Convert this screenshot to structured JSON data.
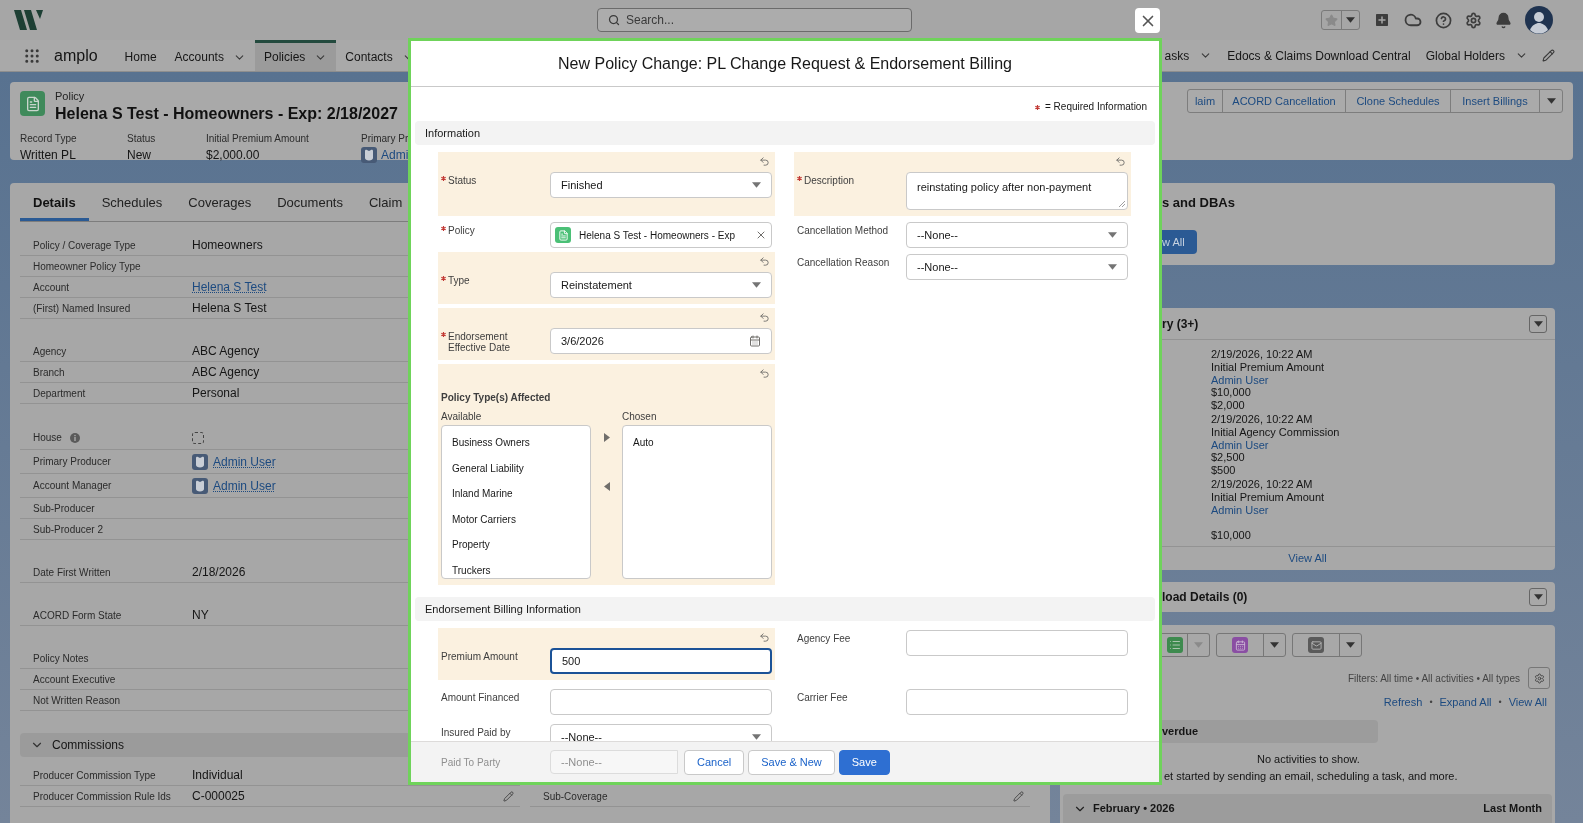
{
  "global_header": {
    "search_placeholder": "Search..."
  },
  "nav": {
    "app_name": "amplo",
    "items": [
      {
        "label": "Home",
        "has_menu": false,
        "selected": false
      },
      {
        "label": "Accounts",
        "has_menu": true,
        "selected": false
      },
      {
        "label": "Policies",
        "has_menu": true,
        "selected": true
      },
      {
        "label": "Contacts",
        "has_menu": true,
        "selected": false
      }
    ],
    "right_items": [
      {
        "label": "asks",
        "has_menu": true
      },
      {
        "label": "Edocs & Claims Download Central",
        "has_menu": false
      },
      {
        "label": "Global Holders",
        "has_menu": true
      }
    ]
  },
  "record": {
    "object_label": "Policy",
    "title": "Helena S Test - Homeowners - Exp: 2/18/2027",
    "fields": [
      {
        "label": "Record Type",
        "value": "Written PL",
        "kind": "text"
      },
      {
        "label": "Status",
        "value": "New",
        "kind": "text"
      },
      {
        "label": "Initial Premium Amount",
        "value": "$2,000.00",
        "kind": "text"
      },
      {
        "label": "Primary Pr",
        "value": "Admi",
        "kind": "user"
      }
    ],
    "actions": [
      "laim",
      "ACORD Cancellation",
      "Clone Schedules",
      "Insert Billings"
    ]
  },
  "tabs": [
    {
      "label": "Details",
      "selected": true
    },
    {
      "label": "Schedules",
      "selected": false
    },
    {
      "label": "Coverages",
      "selected": false
    },
    {
      "label": "Documents",
      "selected": false
    },
    {
      "label": "Claim",
      "selected": false
    }
  ],
  "details": {
    "groups": [
      [
        {
          "label": "Policy / Coverage Type",
          "value": "Homeowners",
          "kind": "text"
        },
        {
          "label": "Homeowner Policy Type",
          "kind": "text"
        },
        {
          "label": "Account",
          "value": "Helena S Test",
          "kind": "link"
        },
        {
          "label": "(First) Named Insured",
          "value": "Helena S Test",
          "kind": "text"
        }
      ],
      [
        {
          "label": "Agency",
          "value": "ABC Agency",
          "kind": "text"
        },
        {
          "label": "Branch",
          "value": "ABC Agency",
          "kind": "text"
        },
        {
          "label": "Department",
          "value": "Personal",
          "kind": "text"
        }
      ],
      [
        {
          "label": "House",
          "kind": "checkbox",
          "checked": false,
          "info": true
        },
        {
          "label": "Primary Producer",
          "value": "Admin User",
          "kind": "user"
        },
        {
          "label": "Account Manager",
          "value": "Admin User",
          "kind": "user"
        },
        {
          "label": "Sub-Producer",
          "kind": "text"
        },
        {
          "label": "Sub-Producer 2",
          "kind": "text"
        }
      ],
      [
        {
          "label": "Date First Written",
          "value": "2/18/2026",
          "kind": "text"
        }
      ],
      [
        {
          "label": "ACORD Form State",
          "value": "NY",
          "kind": "text"
        }
      ],
      [
        {
          "label": "Policy Notes",
          "kind": "text"
        },
        {
          "label": "Account Executive",
          "kind": "text"
        },
        {
          "label": "Not Written Reason",
          "kind": "text"
        }
      ]
    ]
  },
  "commissions": {
    "title": "Commissions",
    "expanded": true,
    "rows": [
      {
        "left": {
          "label": "Producer Commission Type",
          "value": "Individual",
          "editable": false
        }
      },
      {
        "left": {
          "label": "Producer Commission Rule Ids",
          "value": "C-000025",
          "editable": true
        },
        "right": {
          "label": "Sub-Coverage",
          "editable": true
        }
      }
    ]
  },
  "side": {
    "dbas": {
      "title": "s and DBAs",
      "button": "w All"
    },
    "history": {
      "title": "ry (3+)",
      "entries": [
        {
          "date": "2/19/2026, 10:22 AM",
          "field": "Initial Premium Amount",
          "user": "Admin User",
          "new_value": "$10,000",
          "old_value": "$2,000"
        },
        {
          "date": "2/19/2026, 10:22 AM",
          "field": "Initial Agency Commission",
          "user": "Admin User",
          "new_value": "$2,500",
          "old_value": "$500"
        },
        {
          "date": "2/19/2026, 10:22 AM",
          "field": "Initial Premium Amount",
          "user": "Admin User",
          "old_value": "$10,000"
        }
      ],
      "footer_link": "View All"
    },
    "download": {
      "title": "load Details (0)"
    },
    "activity": {
      "composer_buttons": [
        {
          "kind": "task"
        },
        {
          "kind": "event"
        },
        {
          "kind": "email"
        }
      ],
      "filters": "Filters: All time • All activities • All types",
      "links": [
        "Refresh",
        "Expand All",
        "View All"
      ],
      "link_separator": "•",
      "overdue": "verdue",
      "empty_title": "No activities to show.",
      "empty_text": "et started by sending an email, scheduling a task, and more.",
      "month": {
        "label": "February • 2026",
        "note": "Last Month",
        "expanded": true
      }
    }
  },
  "modal": {
    "title": "New Policy Change: PL Change Request & Endorsement Billing",
    "required_note": "= Required Information",
    "sections": [
      {
        "title": "Information",
        "rows": [
          {
            "left": {
              "label": "Status",
              "kind": "select",
              "value": "Finished",
              "required": true,
              "changed": true
            },
            "right": {
              "label": "Description",
              "kind": "textarea",
              "value": "reinstating policy after non-payment",
              "required": true,
              "changed": true
            }
          },
          {
            "left": {
              "label": "Policy",
              "kind": "lookup",
              "value": "Helena S Test - Homeowners - Exp",
              "required": true,
              "changed": false
            },
            "right": {
              "label": "Cancellation Method",
              "kind": "select",
              "value": "--None--",
              "required": false,
              "changed": false
            }
          },
          {
            "left": {
              "label": "Type",
              "kind": "select",
              "value": "Reinstatement",
              "required": true,
              "changed": true
            },
            "right": {
              "label": "Cancellation Reason",
              "kind": "select",
              "value": "--None--",
              "required": false,
              "changed": false
            }
          },
          {
            "left": {
              "label": "Endorsement Effective Date",
              "kind": "date",
              "value": "3/6/2026",
              "required": true,
              "changed": true
            }
          },
          {
            "left": {
              "label": "Policy Type(s) Affected",
              "kind": "dual_list",
              "changed": true,
              "available_label": "Available",
              "chosen_label": "Chosen",
              "available": [
                "Business Owners",
                "General Liability",
                "Inland Marine",
                "Motor Carriers",
                "Property",
                "Truckers"
              ],
              "chosen": [
                "Auto"
              ]
            }
          }
        ]
      },
      {
        "title": "Endorsement Billing Information",
        "rows": [
          {
            "left": {
              "label": "Premium Amount",
              "kind": "input",
              "value": "500",
              "required": false,
              "changed": true,
              "focused": true
            },
            "right": {
              "label": "Agency Fee",
              "kind": "input",
              "required": false,
              "changed": false,
              "focused": false
            }
          },
          {
            "left": {
              "label": "Amount Financed",
              "kind": "input",
              "required": false,
              "changed": false,
              "focused": false
            },
            "right": {
              "label": "Carrier Fee",
              "kind": "input",
              "required": false,
              "changed": false,
              "focused": false
            }
          },
          {
            "left": {
              "label": "Insured Paid by",
              "kind": "select",
              "value": "--None--",
              "required": false,
              "changed": false
            }
          }
        ]
      }
    ],
    "faded_field": {
      "label": "Paid To Party",
      "value": "--None--"
    },
    "buttons": [
      {
        "label": "Cancel",
        "kind": "neutral"
      },
      {
        "label": "Save & New",
        "kind": "neutral"
      },
      {
        "label": "Save",
        "kind": "brand"
      }
    ]
  }
}
